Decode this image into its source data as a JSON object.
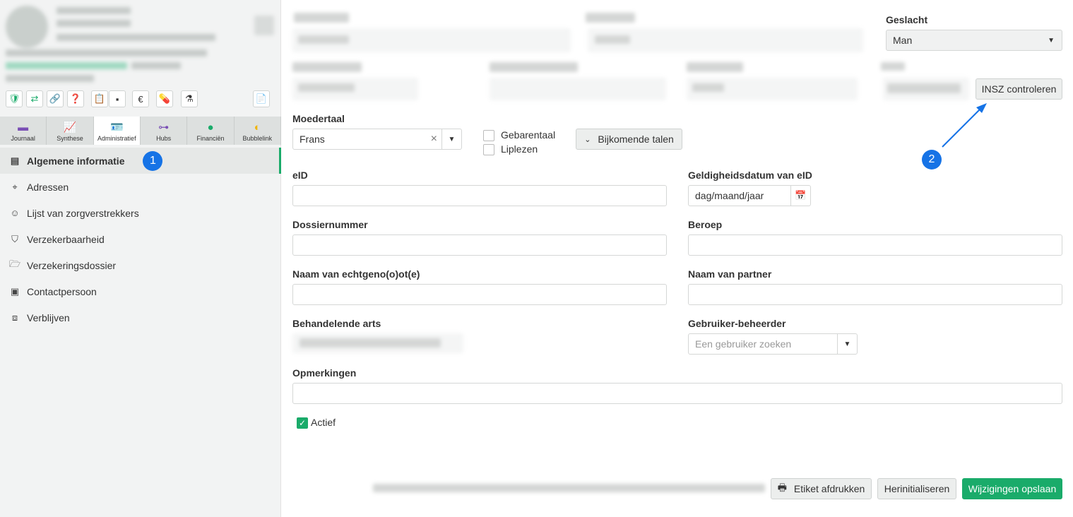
{
  "sidebar": {
    "tabs": [
      {
        "label": "Journaal",
        "icon": "folder-icon"
      },
      {
        "label": "Synthese",
        "icon": "chart-icon"
      },
      {
        "label": "Administratief",
        "icon": "id-card-icon"
      },
      {
        "label": "Hubs",
        "icon": "network-icon"
      },
      {
        "label": "Financiën",
        "icon": "coins-icon"
      },
      {
        "label": "Bubblelink",
        "icon": "bubble-icon"
      }
    ],
    "active_tab": "Administratief",
    "nav": [
      {
        "label": "Algemene informatie",
        "icon": "document-icon",
        "badge": "1"
      },
      {
        "label": "Adressen",
        "icon": "map-pin-icon"
      },
      {
        "label": "Lijst van zorgverstrekkers",
        "icon": "user-icon"
      },
      {
        "label": "Verzekerbaarheid",
        "icon": "shield-icon"
      },
      {
        "label": "Verzekeringsdossier",
        "icon": "folder-open-icon"
      },
      {
        "label": "Contactpersoon",
        "icon": "contact-card-icon"
      },
      {
        "label": "Verblijven",
        "icon": "suitcase-icon"
      }
    ],
    "quick_icons": [
      "shield-check-icon",
      "handshake-icon",
      "link-icon",
      "folder-question-icon",
      "clipboard-plus-icon",
      "sticky-note-icon",
      "euro-icon",
      "pills-icon",
      "flask-icon",
      "pdf-icon"
    ]
  },
  "form": {
    "geslacht": {
      "label": "Geslacht",
      "value": "Man"
    },
    "insz_button": "INSZ controleren",
    "insz_badge": "2",
    "moedertaal": {
      "label": "Moedertaal",
      "value": "Frans"
    },
    "gebarentaal": "Gebarentaal",
    "liplezen": "Liplezen",
    "bijkomende_talen": "Bijkomende talen",
    "eid": {
      "label": "eID",
      "value": ""
    },
    "eid_date": {
      "label": "Geldigheidsdatum van eID",
      "placeholder": "dag/maand/jaar"
    },
    "dossiernummer": {
      "label": "Dossiernummer",
      "value": ""
    },
    "beroep": {
      "label": "Beroep",
      "value": ""
    },
    "echtgenoot": {
      "label": "Naam van echtgeno(o)ot(e)",
      "value": ""
    },
    "partner": {
      "label": "Naam van partner",
      "value": ""
    },
    "arts": {
      "label": "Behandelende arts"
    },
    "gebruiker": {
      "label": "Gebruiker-beheerder",
      "placeholder": "Een gebruiker zoeken"
    },
    "opmerkingen": {
      "label": "Opmerkingen",
      "value": ""
    },
    "actief": {
      "label": "Actief",
      "checked": true
    }
  },
  "footer": {
    "print_label": "Etiket afdrukken",
    "reset_label": "Herinitialiseren",
    "save_label": "Wijzigingen opslaan"
  },
  "colors": {
    "accent": "#1aab6a",
    "annotation": "#1673e6"
  }
}
